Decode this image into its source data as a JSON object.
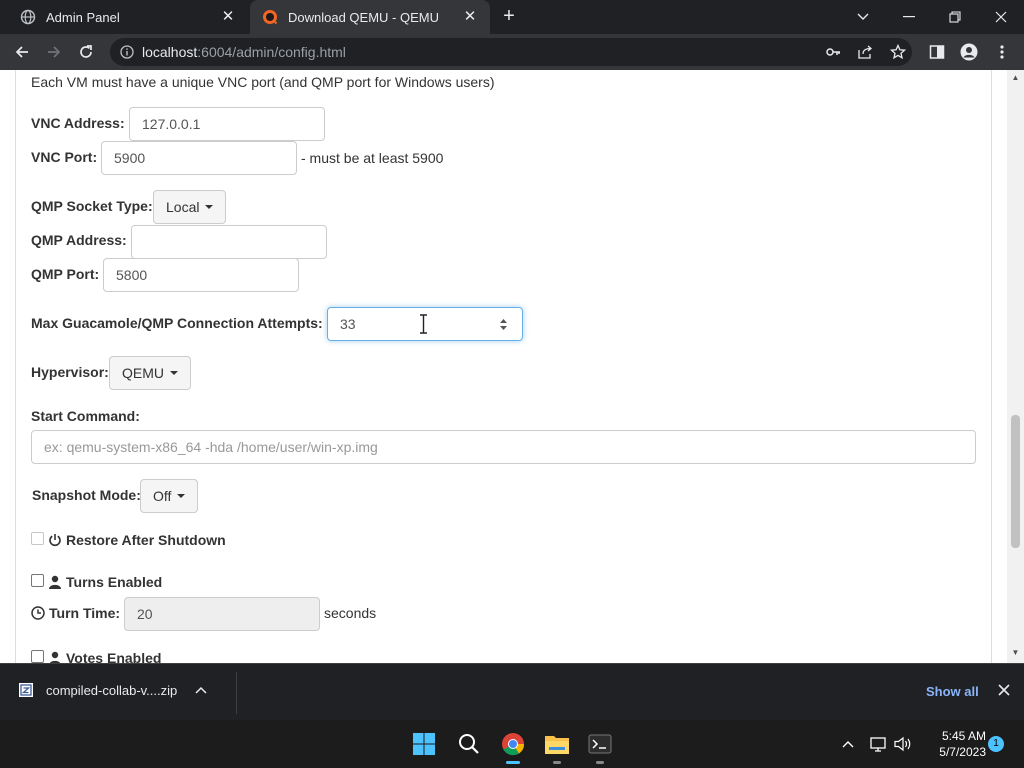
{
  "browser": {
    "tabs": [
      {
        "title": "Admin Panel",
        "active": false
      },
      {
        "title": "Download QEMU - QEMU",
        "active": true
      }
    ],
    "url_host": "localhost",
    "url_path": ":6004/admin/config.html"
  },
  "form": {
    "intro": "Each VM must have a unique VNC port (and QMP port for Windows users)",
    "vnc_address_label": "VNC Address:",
    "vnc_address_value": "127.0.0.1",
    "vnc_port_label": "VNC Port:",
    "vnc_port_value": "5900",
    "vnc_port_hint": "- must be at least 5900",
    "qmp_socket_label": "QMP Socket Type:",
    "qmp_socket_value": "Local",
    "qmp_address_label": "QMP Address:",
    "qmp_address_value": "",
    "qmp_port_label": "QMP Port:",
    "qmp_port_value": "5800",
    "max_attempts_label": "Max Guacamole/QMP Connection Attempts:",
    "max_attempts_value": "33",
    "hypervisor_label": "Hypervisor:",
    "hypervisor_value": "QEMU",
    "start_command_label": "Start Command:",
    "start_command_placeholder": "ex: qemu-system-x86_64 -hda /home/user/win-xp.img",
    "snapshot_label": "Snapshot Mode:",
    "snapshot_value": "Off",
    "restore_label": "Restore After Shutdown",
    "turns_label": "Turns Enabled",
    "turn_time_label": "Turn Time:",
    "turn_time_value": "20",
    "turn_time_unit": "seconds",
    "votes_label": "Votes Enabled"
  },
  "downloads": {
    "filename": "compiled-collab-v....zip",
    "show_all": "Show all"
  },
  "taskbar": {
    "time": "5:45 AM",
    "date": "5/7/2023",
    "notification_count": "1"
  },
  "colors": {
    "accent": "#66afe9",
    "chrome_dark": "#202124",
    "chrome_toolbar": "#35363a",
    "taskbar": "#1c1c1c",
    "show_all_link": "#8ab4f8"
  }
}
